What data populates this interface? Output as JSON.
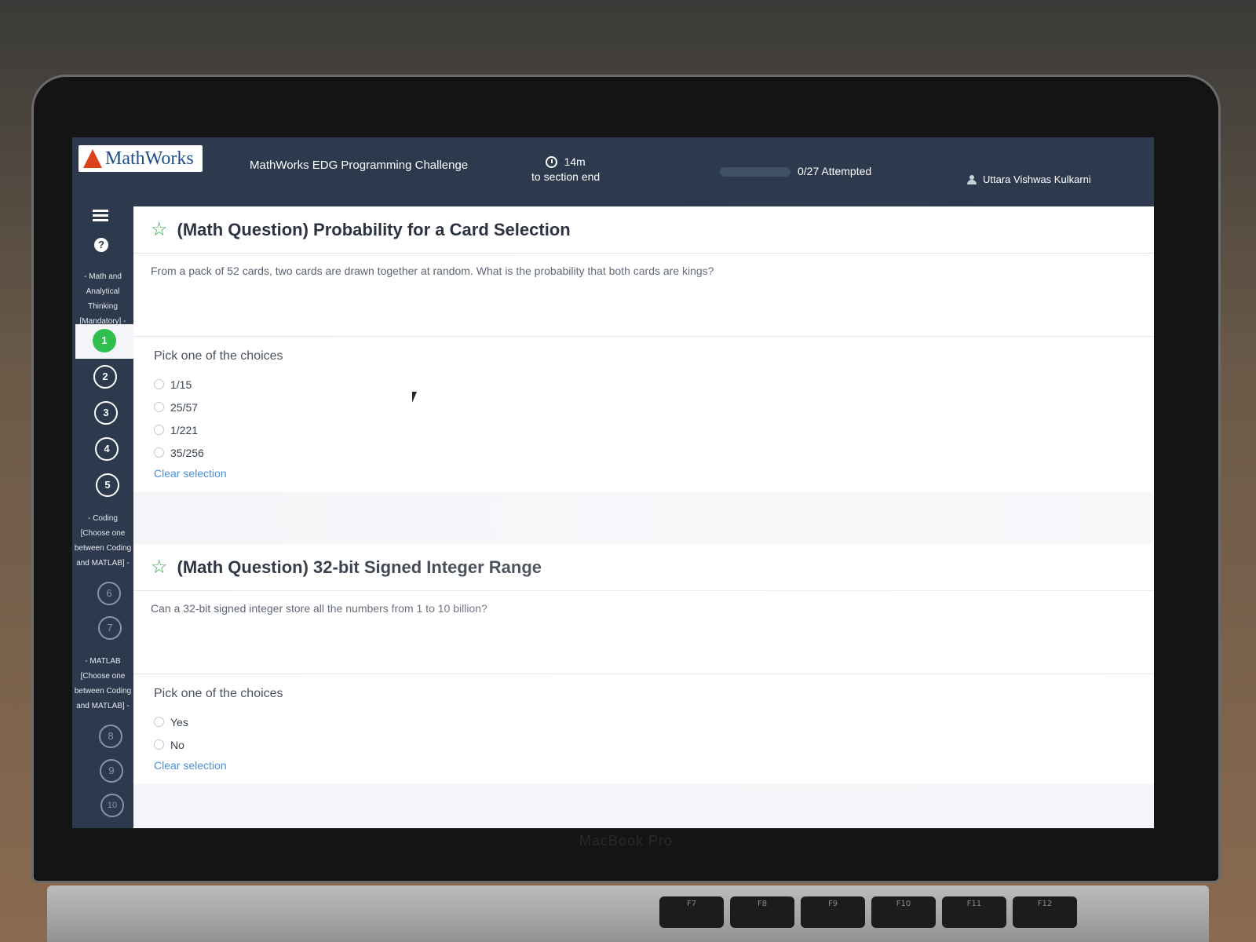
{
  "header": {
    "logo_text": "MathWorks",
    "app_title": "MathWorks EDG Programming Challenge",
    "timer_value": "14m",
    "timer_caption": "to section end",
    "progress_fraction": 0.0,
    "attempted_text": "0/27 Attempted",
    "user_name": "Uttara Vishwas Kulkarni"
  },
  "sidebar": {
    "section1_label": "- Math and Analytical Thinking [Mandatory] -",
    "section2_label": "- Coding [Choose one between Coding and MATLAB] -",
    "section3_label": "- MATLAB [Choose one between Coding and MATLAB] -",
    "questions": [
      "1",
      "2",
      "3",
      "4",
      "5",
      "6",
      "7",
      "8",
      "9",
      "10"
    ],
    "current_question": "1"
  },
  "questions": [
    {
      "title": "(Math Question) Probability for a Card Selection",
      "body": "From a pack of 52 cards, two cards are drawn together at random. What is the probability that both cards are kings?",
      "pick_label": "Pick one of the choices",
      "choices": [
        "1/15",
        "25/57",
        "1/221",
        "35/256"
      ],
      "clear_label": "Clear selection"
    },
    {
      "title": "(Math Question) 32-bit Signed Integer Range",
      "body": "Can a 32-bit signed integer store all the numbers from 1 to 10 billion?",
      "pick_label": "Pick one of the choices",
      "choices": [
        "Yes",
        "No"
      ],
      "clear_label": "Clear selection"
    }
  ],
  "device": {
    "bezel_label": "MacBook Pro",
    "fn_keys": [
      "F7",
      "F8",
      "F9",
      "F10",
      "F11",
      "F12"
    ]
  },
  "colors": {
    "topbar": "#2d3a4d",
    "current_question": "#2fbf4f",
    "link": "#4a8fd6",
    "star": "#3aa34a"
  }
}
